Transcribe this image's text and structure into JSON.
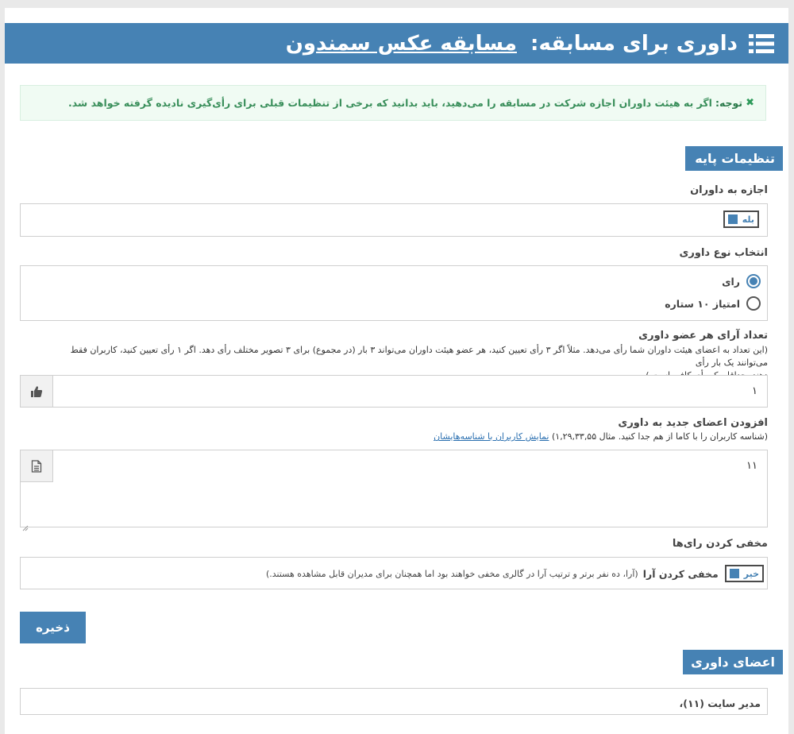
{
  "header": {
    "title_prefix": "داوری برای مسابقه:",
    "contest_name": "مسابقه عکس سمندون"
  },
  "notice": {
    "strong": "توجه:",
    "text": "اگر به هیئت داوران اجازه شرکت در مسابقه را می‌دهید، باید بدانید که برخی از تنظیمات قبلی برای رأی‌گیری نادیده گرفته خواهد شد."
  },
  "basic_settings": {
    "section_title": "تنظیمات پایه",
    "allow_judges": {
      "label": "اجازه به داوران",
      "toggle_label": "بله"
    },
    "judging_type": {
      "label": "انتخاب نوع داوری",
      "options": [
        "رای",
        "امتیاز ۱۰ ستاره"
      ],
      "selected_index": 0
    },
    "votes_per_judge": {
      "label": "تعداد آرای هر عضو داوری",
      "hint_line1": "(این تعداد به اعضای هیئت داوران شما رأی می‌دهد. مثلاً اگر ۳ رأی تعیین کنید، هر عضو هیئت داوران می‌تواند ۳ بار (در مجموع) برای ۳ تصویر مختلف رأی دهد. اگر ۱ رأی تعیین کنید، کاربران فقط می‌توانند یک بار رأی",
      "hint_line2": "دهند. حداقل یک رأی کافی است.)",
      "value": "۱"
    },
    "add_judges": {
      "label": "افزودن اعضای جدید به داوری",
      "hint": "(شناسه کاربران را با کاما از هم جدا کنید. مثال ۱,۲۹,۳۳,۵۵)",
      "link": "نمایش کاربران با شناسه‌هایشان",
      "value": "۱۱"
    },
    "hide_votes": {
      "label": "مخفی کردن رای‌ها",
      "toggle_label": "خیر",
      "option_label": "مخفی کردن آرا",
      "option_hint": "(آرا، ده نفر برتر و ترتیب آرا در گالری مخفی خواهند بود اما همچنان برای مدیران قابل مشاهده هستند.)"
    }
  },
  "save_button": "ذخیره",
  "judges_section": {
    "title": "اعضای داوری",
    "members": "مدیر سایت (۱۱)،"
  },
  "colors": {
    "primary": "#4682b4",
    "notice_bg": "#f0fbf3",
    "notice_text": "#3a8f5b"
  }
}
